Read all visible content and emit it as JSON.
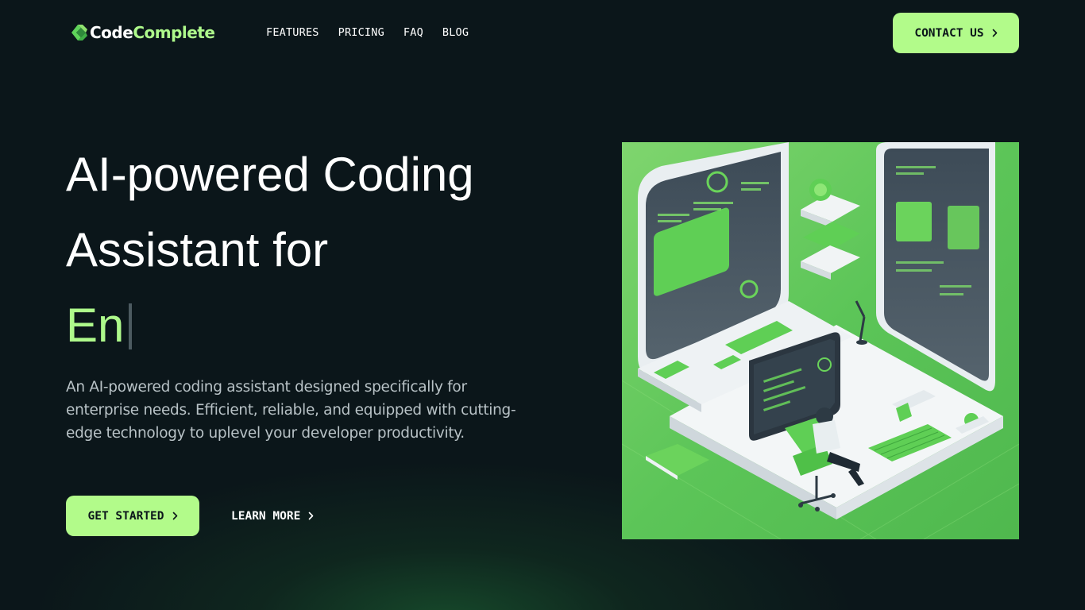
{
  "brand": {
    "name_part1": "Code",
    "name_part2": "Complete",
    "accent_color": "#b2fb8a",
    "background_color": "#0b161a"
  },
  "nav": {
    "links": [
      {
        "label": "FEATURES"
      },
      {
        "label": "PRICING"
      },
      {
        "label": "FAQ"
      },
      {
        "label": "BLOG"
      }
    ],
    "contact_label": "CONTACT US",
    "contact_icon": "chevron-right-icon"
  },
  "hero": {
    "title_line1": "AI-powered Coding",
    "title_line2": "Assistant for",
    "typed_text": "En",
    "description": "An AI-powered coding assistant designed specifically for enterprise needs. Efficient, reliable, and equipped with cutting-edge technology to uplevel your developer productivity.",
    "primary_cta": "GET STARTED",
    "secondary_cta": "LEARN MORE",
    "image_subject": "isometric developer workstation illustration"
  }
}
